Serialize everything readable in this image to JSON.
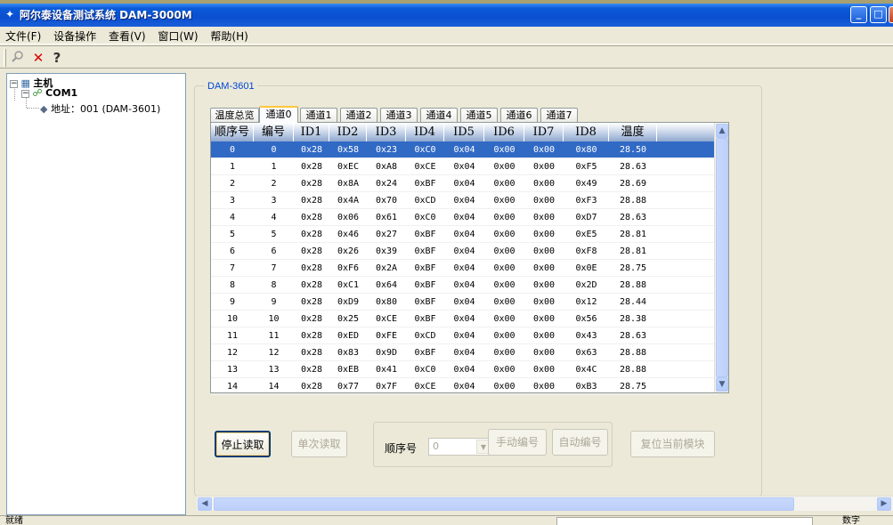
{
  "window": {
    "title": "阿尔泰设备测试系统 DAM-3000M"
  },
  "menu": [
    "文件(F)",
    "设备操作",
    "查看(V)",
    "窗口(W)",
    "帮助(H)"
  ],
  "toolbar": {
    "icons": [
      "search-icon",
      "delete-icon",
      "help-icon"
    ]
  },
  "tree": {
    "root": "主机",
    "port": "COM1",
    "device": "地址：001 (DAM-3601)"
  },
  "panel": {
    "group_label": "DAM-3601",
    "tabs": [
      "温度总览",
      "通道0",
      "通道1",
      "通道2",
      "通道3",
      "通道4",
      "通道5",
      "通道6",
      "通道7"
    ],
    "active_tab": 1
  },
  "grid": {
    "headers": [
      "顺序号",
      "编号",
      "ID1",
      "ID2",
      "ID3",
      "ID4",
      "ID5",
      "ID6",
      "ID7",
      "ID8",
      "温度"
    ],
    "rows": [
      [
        "0",
        "0",
        "0x28",
        "0x58",
        "0x23",
        "0xC0",
        "0x04",
        "0x00",
        "0x00",
        "0x80",
        "28.50"
      ],
      [
        "1",
        "1",
        "0x28",
        "0xEC",
        "0xA8",
        "0xCE",
        "0x04",
        "0x00",
        "0x00",
        "0xF5",
        "28.63"
      ],
      [
        "2",
        "2",
        "0x28",
        "0x8A",
        "0x24",
        "0xBF",
        "0x04",
        "0x00",
        "0x00",
        "0x49",
        "28.69"
      ],
      [
        "3",
        "3",
        "0x28",
        "0x4A",
        "0x70",
        "0xCD",
        "0x04",
        "0x00",
        "0x00",
        "0xF3",
        "28.88"
      ],
      [
        "4",
        "4",
        "0x28",
        "0x06",
        "0x61",
        "0xC0",
        "0x04",
        "0x00",
        "0x00",
        "0xD7",
        "28.63"
      ],
      [
        "5",
        "5",
        "0x28",
        "0x46",
        "0x27",
        "0xBF",
        "0x04",
        "0x00",
        "0x00",
        "0xE5",
        "28.81"
      ],
      [
        "6",
        "6",
        "0x28",
        "0x26",
        "0x39",
        "0xBF",
        "0x04",
        "0x00",
        "0x00",
        "0xF8",
        "28.81"
      ],
      [
        "7",
        "7",
        "0x28",
        "0xF6",
        "0x2A",
        "0xBF",
        "0x04",
        "0x00",
        "0x00",
        "0x0E",
        "28.75"
      ],
      [
        "8",
        "8",
        "0x28",
        "0xC1",
        "0x64",
        "0xBF",
        "0x04",
        "0x00",
        "0x00",
        "0x2D",
        "28.88"
      ],
      [
        "9",
        "9",
        "0x28",
        "0xD9",
        "0x80",
        "0xBF",
        "0x04",
        "0x00",
        "0x00",
        "0x12",
        "28.44"
      ],
      [
        "10",
        "10",
        "0x28",
        "0x25",
        "0xCE",
        "0xBF",
        "0x04",
        "0x00",
        "0x00",
        "0x56",
        "28.38"
      ],
      [
        "11",
        "11",
        "0x28",
        "0xED",
        "0xFE",
        "0xCD",
        "0x04",
        "0x00",
        "0x00",
        "0x43",
        "28.63"
      ],
      [
        "12",
        "12",
        "0x28",
        "0x83",
        "0x9D",
        "0xBF",
        "0x04",
        "0x00",
        "0x00",
        "0x63",
        "28.88"
      ],
      [
        "13",
        "13",
        "0x28",
        "0xEB",
        "0x41",
        "0xC0",
        "0x04",
        "0x00",
        "0x00",
        "0x4C",
        "28.88"
      ],
      [
        "14",
        "14",
        "0x28",
        "0x77",
        "0x7F",
        "0xCE",
        "0x04",
        "0x00",
        "0x00",
        "0xB3",
        "28.75"
      ]
    ],
    "selected_row": 0
  },
  "buttons": {
    "stop_read": "停止读取",
    "single_read": "单次读取",
    "seq_label": "顺序号",
    "seq_value": "0",
    "manual_number": "手动编号",
    "auto_number": "自动编号",
    "reset_module": "复位当前模块"
  },
  "status": {
    "text": "就绪",
    "num": "数字"
  },
  "colors": {
    "selection": "#316ac5",
    "title_bar": "#0a4fd0",
    "accent_label": "#0046d5"
  }
}
